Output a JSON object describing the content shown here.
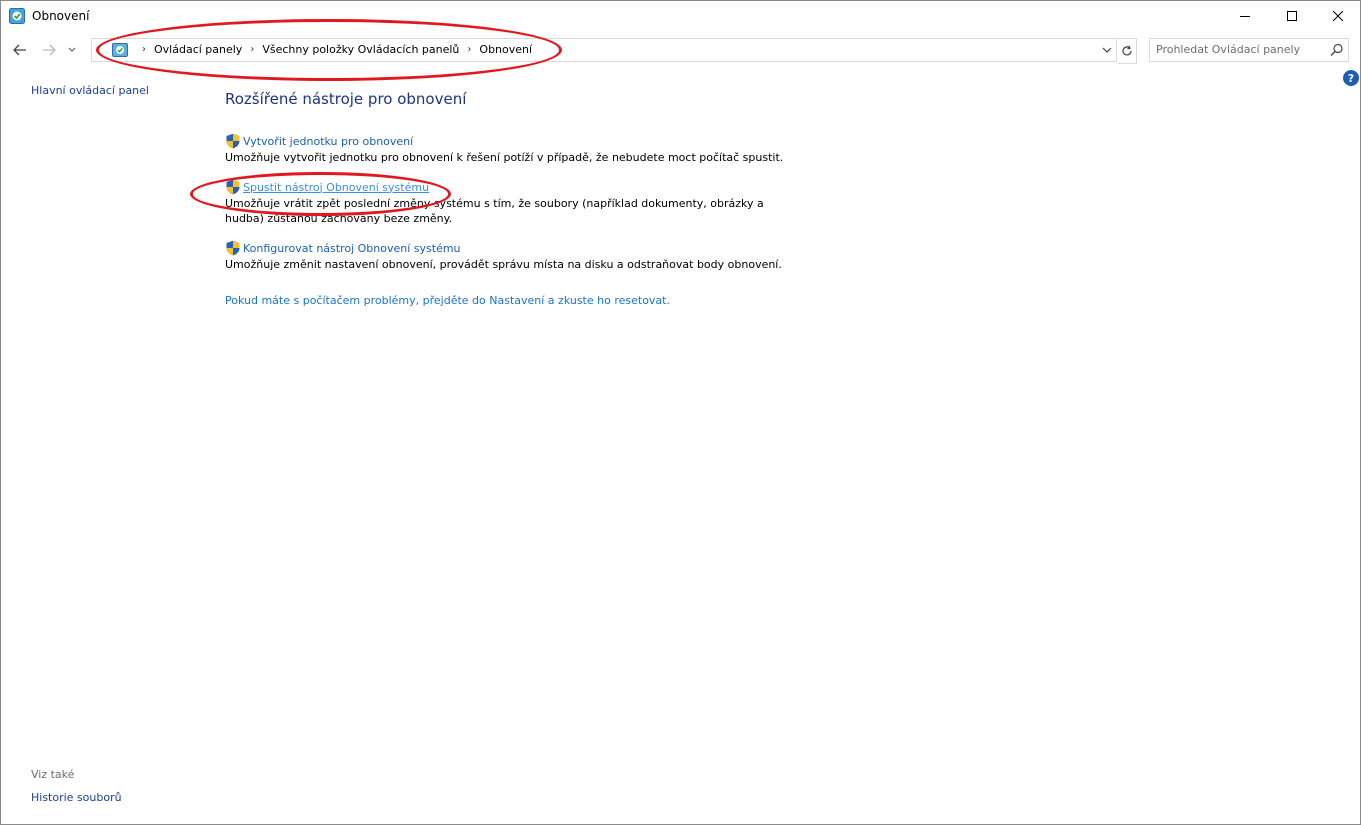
{
  "window": {
    "title": "Obnovení"
  },
  "nav": {
    "breadcrumbs": [
      "Ovládací panely",
      "Všechny položky Ovládacích panelů",
      "Obnovení"
    ],
    "search_placeholder": "Prohledat Ovládací panely"
  },
  "sidebar": {
    "home_link": "Hlavní ovládací panel",
    "see_also_label": "Viz také",
    "see_also_items": [
      "Historie souborů"
    ]
  },
  "main": {
    "heading": "Rozšířené nástroje pro obnovení",
    "items": [
      {
        "label": "Vytvořit jednotku pro obnovení",
        "desc": "Umožňuje vytvořit jednotku pro obnovení k řešení potíží v případě, že nebudete moct  počítač spustit."
      },
      {
        "label": "Spustit nástroj Obnovení systému",
        "desc": "Umožňuje vrátit zpět poslední změny systému s tím, že soubory (například dokumenty, obrázky a hudba) zůstanou zachovány beze změny."
      },
      {
        "label": "Konfigurovat nástroj Obnovení systému",
        "desc": "Umožňuje změnit nastavení obnovení, provádět správu místa na disku a odstraňovat body obnovení."
      }
    ],
    "reset_link": "Pokud máte s počítačem problémy, přejděte do Nastavení a zkuste ho resetovat."
  },
  "help_label": "?",
  "colors": {
    "link": "#1a5fb4",
    "heading": "#1e3287",
    "annotation": "#e0191f"
  }
}
